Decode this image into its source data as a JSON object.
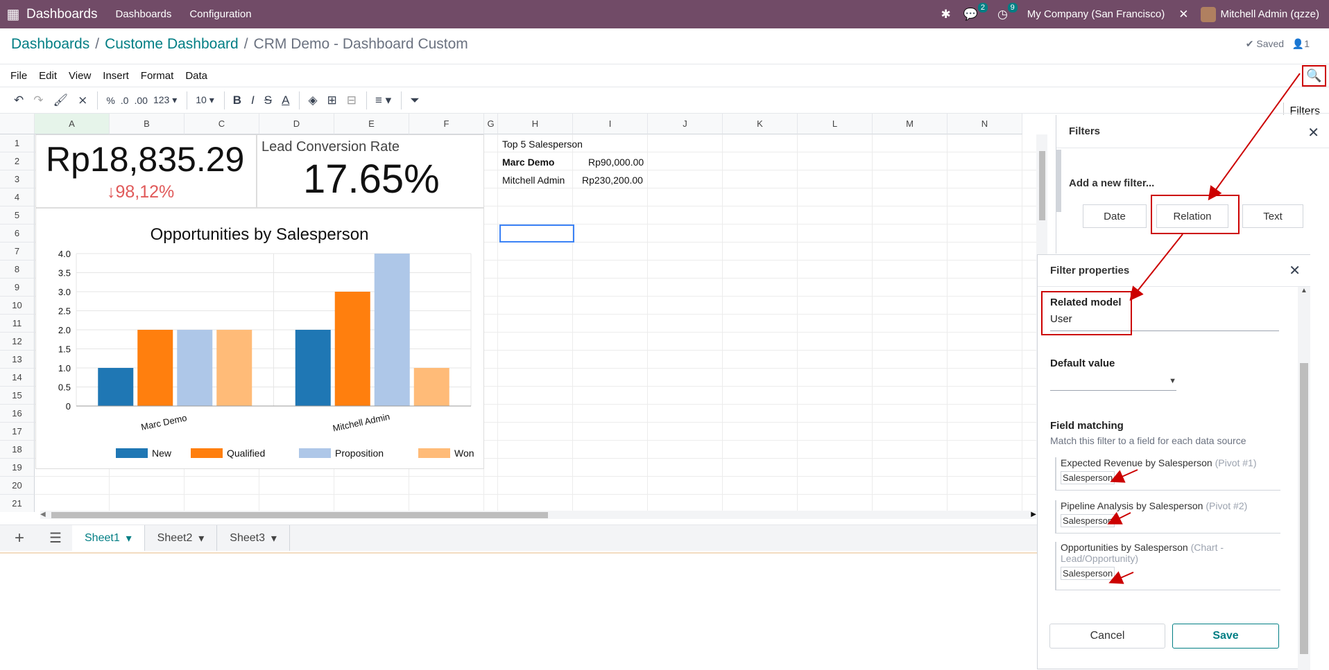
{
  "topbar": {
    "brand": "Dashboards",
    "menu": [
      "Dashboards",
      "Configuration"
    ],
    "chat_count": "2",
    "activity_count": "9",
    "company": "My Company (San Francisco)",
    "user": "Mitchell Admin (qzze)"
  },
  "breadcrumb": {
    "items": [
      "Dashboards",
      "Custome Dashboard"
    ],
    "current": "CRM Demo - Dashboard Custom"
  },
  "status": {
    "saved": "Saved",
    "users": "1"
  },
  "menubar": [
    "File",
    "Edit",
    "View",
    "Insert",
    "Format",
    "Data"
  ],
  "toolbar": {
    "percent": "%",
    "dec_less": ".0",
    "dec_more": ".00",
    "format": "123",
    "font_size": "10"
  },
  "tooltip": "Filters",
  "columns": [
    "A",
    "B",
    "C",
    "D",
    "E",
    "F",
    "G",
    "H",
    "I",
    "J",
    "K",
    "L",
    "M",
    "N"
  ],
  "rows": [
    "1",
    "2",
    "3",
    "4",
    "5",
    "6",
    "7",
    "8",
    "9",
    "10",
    "11",
    "12",
    "13",
    "14",
    "15",
    "16",
    "17",
    "18",
    "19",
    "20",
    "21"
  ],
  "kpi": {
    "revenue": "Rp18,835.29",
    "revenue_change": "98,12%",
    "conversion_label": "Lead Conversion Rate",
    "conversion_value": "17.65%"
  },
  "table": {
    "title": "Top 5 Salesperson",
    "rows": [
      {
        "name": "Marc Demo",
        "value": "Rp90,000.00"
      },
      {
        "name": "Mitchell Admin",
        "value": "Rp230,200.00"
      }
    ]
  },
  "chart_data": {
    "type": "bar",
    "title": "Opportunities by Salesperson",
    "categories": [
      "Marc Demo",
      "Mitchell Admin"
    ],
    "series": [
      {
        "name": "New",
        "values": [
          1,
          2
        ],
        "color": "#1f77b4"
      },
      {
        "name": "Qualified",
        "values": [
          2,
          3
        ],
        "color": "#ff7f0e"
      },
      {
        "name": "Proposition",
        "values": [
          2,
          4
        ],
        "color": "#aec7e8"
      },
      {
        "name": "Won",
        "values": [
          2,
          1
        ],
        "color": "#ffbb78"
      }
    ],
    "ylim": [
      0,
      4
    ],
    "yticks": [
      "0",
      "0.5",
      "1.0",
      "1.5",
      "2.0",
      "2.5",
      "3.0",
      "3.5",
      "4.0"
    ],
    "grid": true,
    "legend": "bottom"
  },
  "sheets": [
    "Sheet1",
    "Sheet2",
    "Sheet3"
  ],
  "filters": {
    "title": "Filters",
    "add_label": "Add a new filter...",
    "types": [
      "Date",
      "Relation",
      "Text"
    ]
  },
  "filter_props": {
    "title": "Filter properties",
    "related_model_label": "Related model",
    "related_model_value": "User",
    "default_value_label": "Default value",
    "field_matching_label": "Field matching",
    "field_matching_help": "Match this filter to a field for each data source",
    "sources": [
      {
        "name": "Expected Revenue by Salesperson",
        "type": "(Pivot #1)",
        "field": "Salesperson"
      },
      {
        "name": "Pipeline Analysis by Salesperson",
        "type": "(Pivot #2)",
        "field": "Salesperson"
      },
      {
        "name": "Opportunities by Salesperson",
        "type": "(Chart - Lead/Opportunity)",
        "field": "Salesperson"
      }
    ],
    "cancel": "Cancel",
    "save": "Save"
  }
}
